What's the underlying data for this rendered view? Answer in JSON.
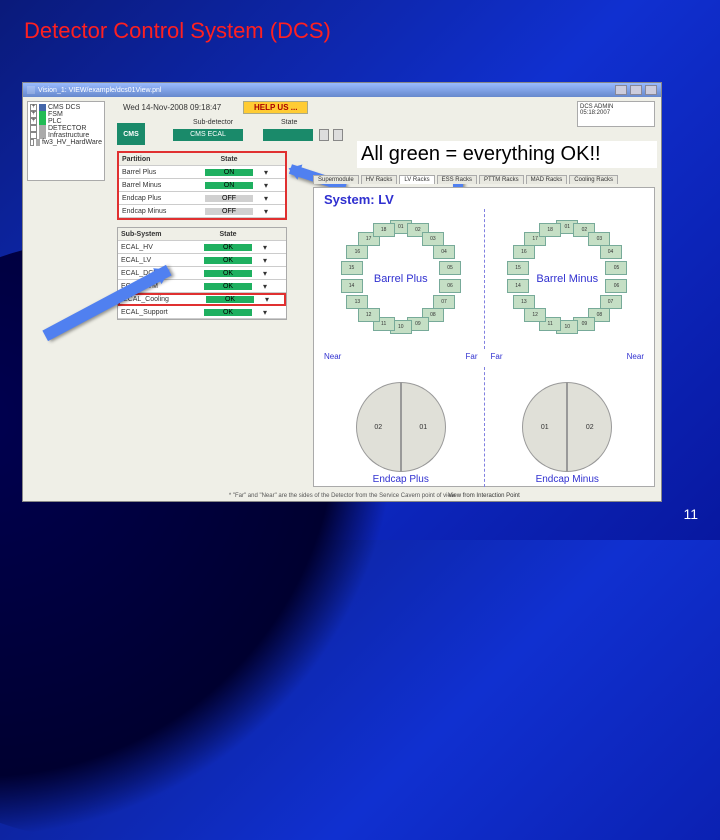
{
  "slide": {
    "title": "Detector Control System (DCS)",
    "page_number": "11"
  },
  "window": {
    "title": "Vision_1: VIEW/example/dcs01View.pnl"
  },
  "tree": {
    "items": [
      {
        "label": "CMS DCS",
        "color": "blue-dot"
      },
      {
        "label": "FSM",
        "color": "green-dot"
      },
      {
        "label": "PLC",
        "color": "green-dot"
      },
      {
        "label": "DETECTOR",
        "color": "grey-dot"
      },
      {
        "label": "Infrastructure",
        "color": "grey-dot"
      },
      {
        "label": "fw3_HV_HardWare",
        "color": "grey-dot"
      }
    ]
  },
  "header": {
    "datetime": "Wed 14-Nov-2008   09:18:47",
    "help": "HELP US ...",
    "info_box1": "DCS ADMIN",
    "info_box2": "05:18:2007"
  },
  "subdetector": {
    "label": "Sub-detector",
    "value": "CMS ECAL",
    "state_label": "State"
  },
  "partition": {
    "title1": "Partition",
    "title2": "State",
    "rows": [
      {
        "name": "Barrel Plus",
        "state": "ON",
        "cls": "on"
      },
      {
        "name": "Barrel Minus",
        "state": "ON",
        "cls": "on"
      },
      {
        "name": "Endcap Plus",
        "state": "OFF",
        "cls": "off"
      },
      {
        "name": "Endcap Minus",
        "state": "OFF",
        "cls": "off"
      }
    ]
  },
  "subsystem": {
    "title1": "Sub-System",
    "title2": "State",
    "rows": [
      {
        "name": "ECAL_HV",
        "state": "OK",
        "cls": "ok"
      },
      {
        "name": "ECAL_LV",
        "state": "OK",
        "cls": "ok"
      },
      {
        "name": "ECAL_DCU",
        "state": "OK",
        "cls": "ok"
      },
      {
        "name": "ECAL_PTM",
        "state": "OK",
        "cls": "ok"
      },
      {
        "name": "ECAL_Cooling",
        "state": "OK",
        "cls": "ok",
        "highlight": true
      },
      {
        "name": "ECAL_Support",
        "state": "OK",
        "cls": "ok"
      }
    ]
  },
  "overlay": {
    "text": "All green = everything OK!!"
  },
  "tabs": [
    "Supermodule",
    "HV Racks",
    "LV Racks",
    "ESS Racks",
    "PTTM Racks",
    "MAD Racks",
    "Cooling Racks"
  ],
  "system": {
    "title": "System: LV",
    "barrel_plus": "Barrel Plus",
    "barrel_minus": "Barrel Minus",
    "near": "Near",
    "far": "Far",
    "endcap_plus": "Endcap Plus",
    "endcap_minus": "Endcap Minus",
    "ec_halves": [
      "02",
      "01",
      "01",
      "02"
    ],
    "caption": "View from Interaction Point",
    "footnote": "* \"Far\" and \"Near\" are the sides of the Detector from the Service Cavern point of view"
  },
  "ring_slices": [
    "01",
    "02",
    "03",
    "04",
    "05",
    "06",
    "07",
    "08",
    "09",
    "10",
    "11",
    "12",
    "13",
    "14",
    "15",
    "16",
    "17",
    "18"
  ]
}
